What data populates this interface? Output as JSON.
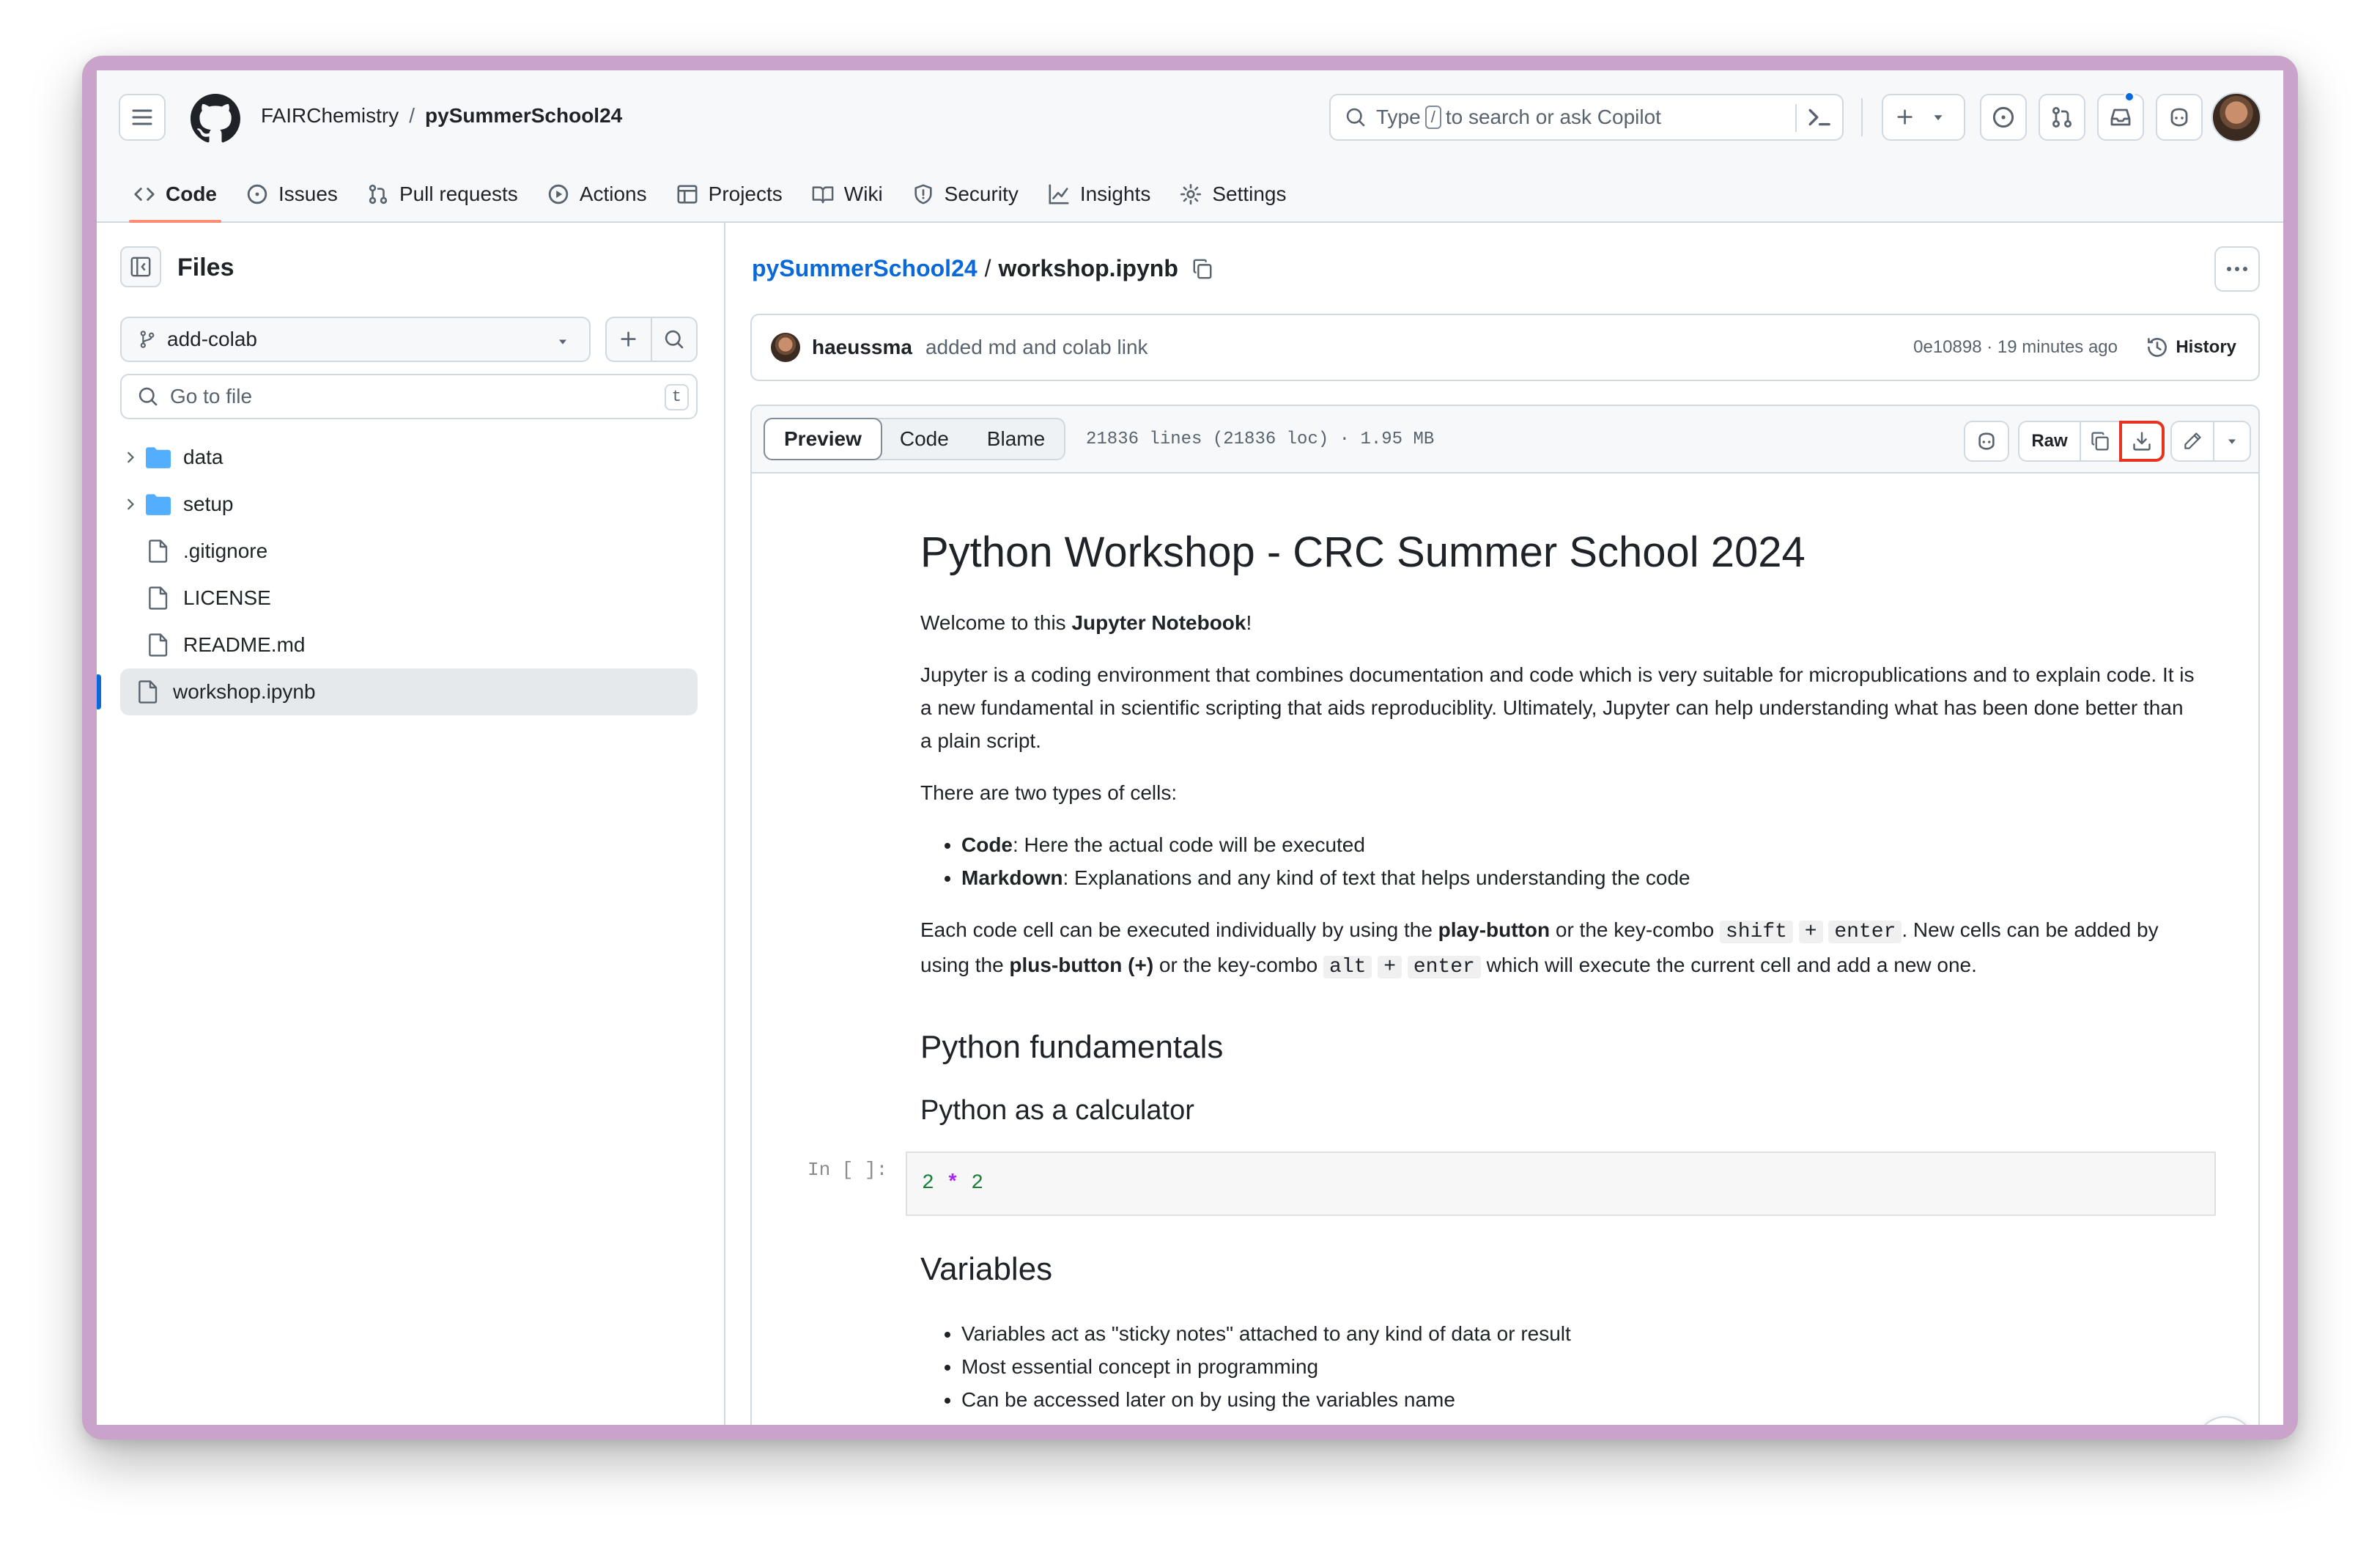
{
  "header": {
    "owner": "FAIRChemistry",
    "separator": "/",
    "repo": "pySummerSchool24",
    "search_prefix": "Type",
    "search_key": "/",
    "search_suffix": "to search or ask Copilot"
  },
  "tabs": [
    {
      "label": "Code",
      "icon": "code-icon",
      "active": true
    },
    {
      "label": "Issues",
      "icon": "issue-icon"
    },
    {
      "label": "Pull requests",
      "icon": "pull-request-icon"
    },
    {
      "label": "Actions",
      "icon": "play-icon"
    },
    {
      "label": "Projects",
      "icon": "table-icon"
    },
    {
      "label": "Wiki",
      "icon": "book-icon"
    },
    {
      "label": "Security",
      "icon": "shield-icon"
    },
    {
      "label": "Insights",
      "icon": "graph-icon"
    },
    {
      "label": "Settings",
      "icon": "gear-icon"
    }
  ],
  "sidebar": {
    "title": "Files",
    "branch": "add-colab",
    "goto_placeholder": "Go to file",
    "goto_key": "t",
    "items": [
      {
        "name": "data",
        "type": "folder"
      },
      {
        "name": "setup",
        "type": "folder"
      },
      {
        "name": ".gitignore",
        "type": "file"
      },
      {
        "name": "LICENSE",
        "type": "file"
      },
      {
        "name": "README.md",
        "type": "file"
      },
      {
        "name": "workshop.ipynb",
        "type": "file",
        "selected": true
      }
    ]
  },
  "file": {
    "repo_link": "pySummerSchool24",
    "sep": "/",
    "name": "workshop.ipynb"
  },
  "commit": {
    "author": "haeussma",
    "message": "added md and colab link",
    "meta": "0e10898 · 19 minutes ago",
    "history_label": "History"
  },
  "toolbar": {
    "views": [
      "Preview",
      "Code",
      "Blame"
    ],
    "active_view": "Preview",
    "stats": "21836 lines (21836 loc) · 1.95 MB",
    "raw_label": "Raw",
    "highlight_color": "#e5331f"
  },
  "notebook": {
    "title": "Python Workshop - CRC Summer School 2024",
    "welcome_prefix": "Welcome to this ",
    "welcome_bold": "Jupyter Notebook",
    "welcome_suffix": "!",
    "intro": "Jupyter is a coding environment that combines documentation and code which is very suitable for micropublications and to explain code. It is a new fundamental in scientific scripting that aids reproduciblity. Ultimately, Jupyter can help understanding what has been done better than a plain script.",
    "cells_intro": "There are two types of cells:",
    "cell_types": [
      {
        "bold": "Code",
        "text": ": Here the actual code will be executed"
      },
      {
        "bold": "Markdown",
        "text": ": Explanations and any kind of text that helps understanding the code"
      }
    ],
    "exec_p1": "Each code cell can be executed individually by using the ",
    "exec_b1": "play-button",
    "exec_p2": " or the key-combo ",
    "exec_c1": "shift",
    "exec_plus": "+",
    "exec_c2": "enter",
    "exec_p3": ". New cells can be added by using the ",
    "exec_b2": "plus-button (+)",
    "exec_p4": " or the key-combo ",
    "exec_c3": "alt",
    "exec_c4": "enter",
    "exec_p5": " which will execute the current cell and add a new one.",
    "h2_fundamentals": "Python fundamentals",
    "h3_calc": "Python as a calculator",
    "cell_prompt": "In [ ]:",
    "cell_code_a": "2",
    "cell_code_op": "*",
    "cell_code_b": "2",
    "h2_variables": "Variables",
    "var_bullets": [
      "Variables act as \"sticky notes\" attached to any kind of data or result",
      "Most essential concept in programming",
      "Can be accessed later on by using the variables name"
    ]
  }
}
